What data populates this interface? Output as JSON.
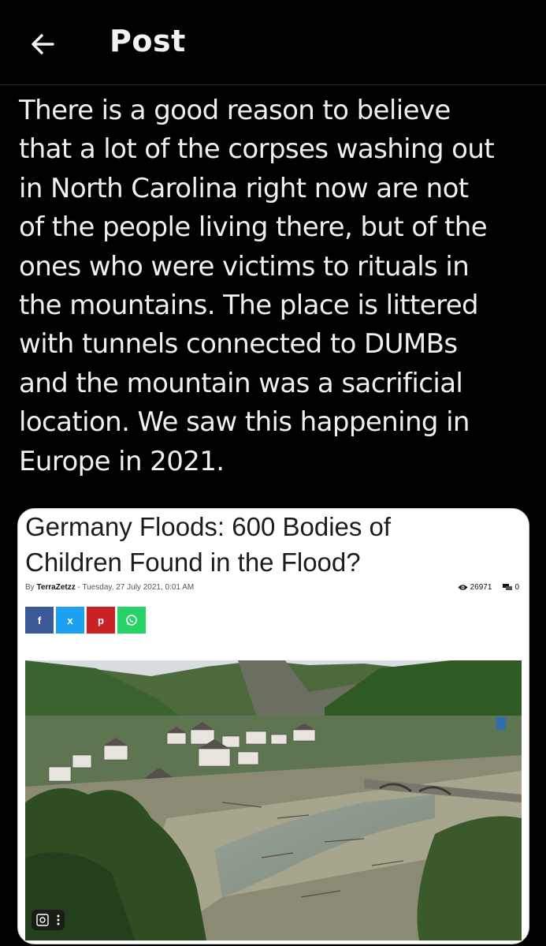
{
  "header": {
    "title": "Post"
  },
  "post": {
    "text": "There is a good reason to believe\nthat a lot of the corpses washing out\nin North Carolina right now are not\nof the people living there, but of the\nones who were victims to rituals in\nthe mountains. The place is littered\nwith tunnels connected to DUMBs\nand the mountain was a sacrificial\nlocation. We saw this happening in\nEurope in 2021."
  },
  "article": {
    "title": "Germany Floods: 600 Bodies of\nChildren Found in the Flood?",
    "by": "By",
    "author": "TerraZetzz",
    "date": "- Tuesday, 27 July 2021, 0:01 AM",
    "views": "26971",
    "comments": "0",
    "share": {
      "facebook": "f",
      "x": "x",
      "pinterest": "p",
      "whatsapp_color": "#25d366",
      "facebook_color": "#3b5998",
      "x_color": "#1da1f2",
      "pinterest_color": "#ca2127"
    }
  },
  "colors": {
    "background": "#000000",
    "text": "#e7e9ea"
  }
}
